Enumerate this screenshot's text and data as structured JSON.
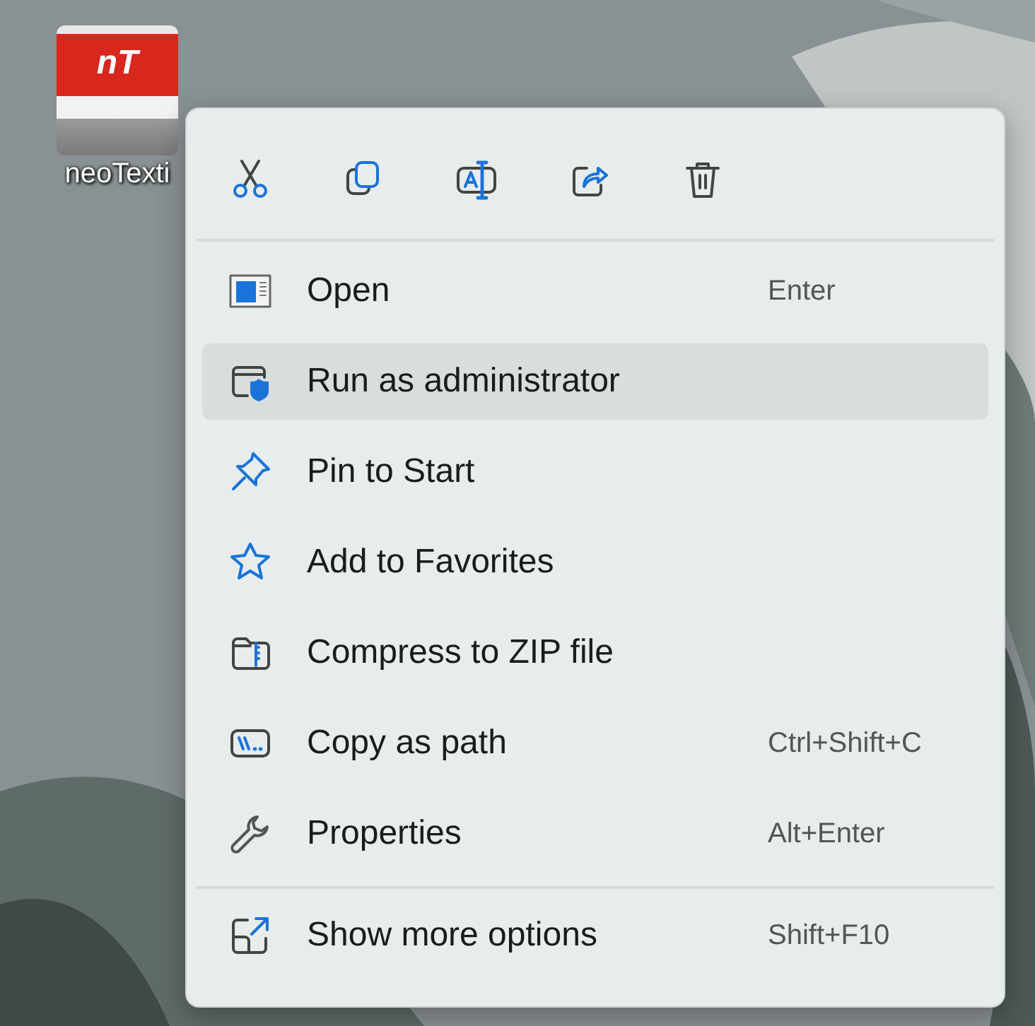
{
  "desktop_icon": {
    "logo_text": "nT",
    "label": "neoTexti"
  },
  "context_menu": {
    "items": [
      {
        "label": "Open",
        "shortcut": "Enter",
        "selected": false
      },
      {
        "label": "Run as administrator",
        "selected": true
      },
      {
        "label": "Pin to Start",
        "selected": false
      },
      {
        "label": "Add to Favorites",
        "selected": false
      },
      {
        "label": "Compress to ZIP file",
        "selected": false
      },
      {
        "label": "Copy as path",
        "shortcut": "Ctrl+Shift+C",
        "selected": false
      },
      {
        "label": "Properties",
        "shortcut": "Alt+Enter",
        "selected": false
      }
    ],
    "footer_item": {
      "label": "Show more options",
      "shortcut": "Shift+F10",
      "selected": false
    }
  }
}
